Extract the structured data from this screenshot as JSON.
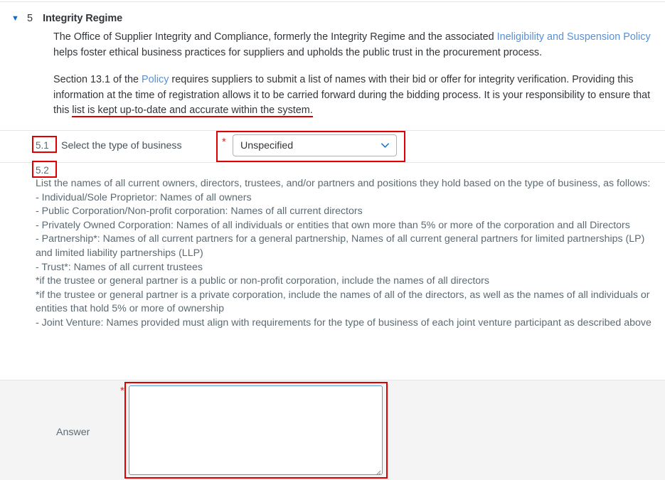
{
  "section": {
    "caret_icon": "triangle-down-icon",
    "number": "5",
    "title": "Integrity Regime"
  },
  "intro": {
    "paragraph1_part1": "The Office of Supplier Integrity and Compliance, formerly the Integrity Regime and the associated ",
    "paragraph1_link": "Ineligibility and Suspension Policy",
    "paragraph1_part2": " helps foster ethical business practices for suppliers and upholds the public trust in the procurement process.",
    "paragraph2_part1": "Section 13.1 of the ",
    "paragraph2_link": "Policy",
    "paragraph2_part2": " requires suppliers to submit a list of names with their bid or offer for integrity verification. Providing this information at the time of registration allows it to be carried forward during the bidding process. It is your responsibility to ensure that this ",
    "paragraph2_highlighted": "list is kept up-to-date and accurate within the system.",
    "link_color": "#5a8fd6"
  },
  "question_51": {
    "number": "5.1",
    "label": "Select the type of business",
    "required_marker": "*",
    "dropdown": {
      "selected_value": "Unspecified",
      "chevron_icon": "chevron-down-icon"
    }
  },
  "question_52": {
    "number": "5.2",
    "body": "List the names of all current owners, directors, trustees, and/or partners and positions they hold based on the type of business, as follows:\n- Individual/Sole Proprietor: Names of all owners\n- Public Corporation/Non-profit corporation: Names of all current directors\n- Privately Owned Corporation: Names of all individuals or entities that own more than 5% or more of the corporation and all Directors\n- Partnership*: Names of all current partners for a general partnership, Names of all current general partners for limited partnerships (LP) and limited liability partnerships (LLP)\n- Trust*: Names of all current trustees\n*if the trustee or general partner is a public or non-profit corporation, include the names of all directors\n*if the trustee or general partner is a private corporation, include the names of all of the directors, as well as the names of all individuals or entities that hold 5% or more of ownership\n- Joint Venture: Names provided must align with requirements for the type of business of each joint venture participant as described above"
  },
  "answer": {
    "label": "Answer",
    "required_marker": "*",
    "value": "",
    "placeholder": ""
  },
  "annotations": {
    "color": "#e00000",
    "boxes": [
      "5.1-number",
      "type-of-business-dropdown",
      "5.2-number",
      "answer-textarea"
    ],
    "underline": "list is kept up-to-date and accurate within the system."
  }
}
